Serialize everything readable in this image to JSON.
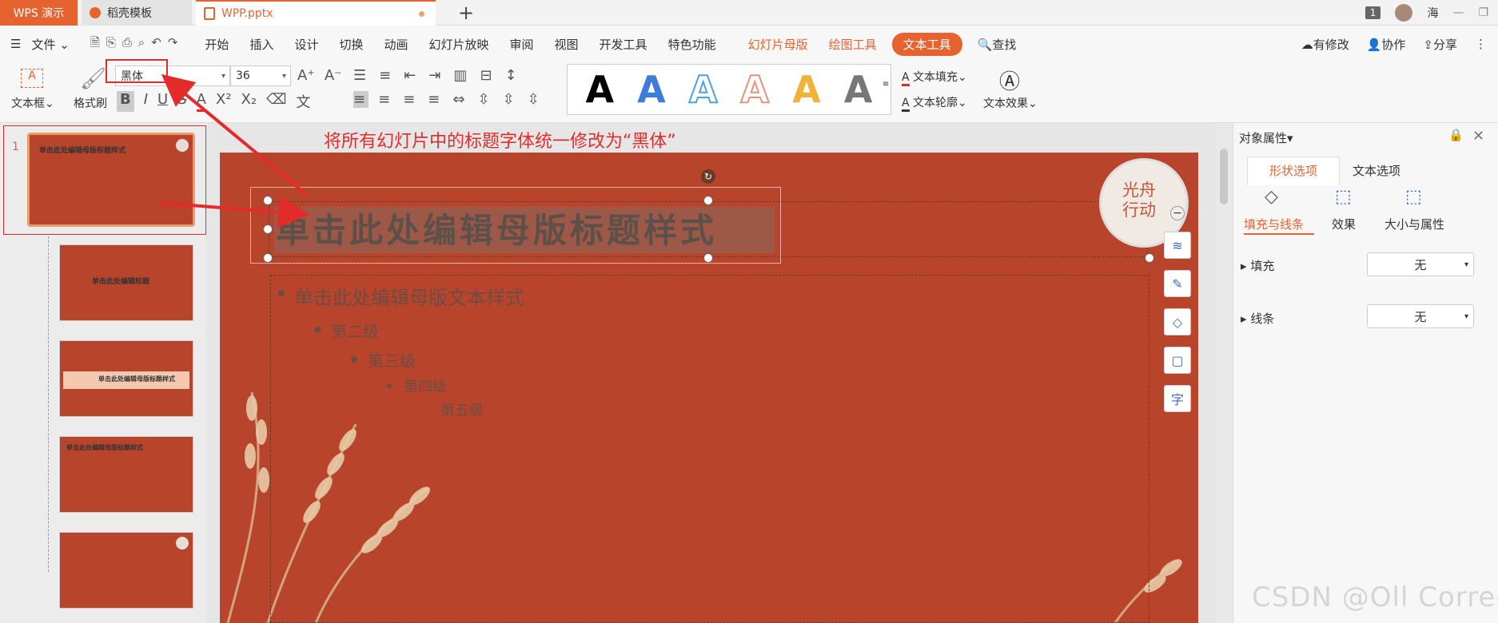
{
  "tabs": {
    "app": "WPS 演示",
    "template": "稻壳模板",
    "file": "WPP.pptx"
  },
  "titlebar_right": {
    "badge": "1",
    "user": "海"
  },
  "menu": {
    "file": "文件",
    "items": [
      "开始",
      "插入",
      "设计",
      "切换",
      "动画",
      "幻灯片放映",
      "审阅",
      "视图",
      "开发工具",
      "特色功能"
    ],
    "master": "幻灯片母版",
    "drawing": "绘图工具",
    "text_tool": "文本工具",
    "search": "查找",
    "modified": "有修改",
    "collab": "协作",
    "share": "分享"
  },
  "ribbon": {
    "textbox": "文本框",
    "format_painter": "格式刷",
    "font": "黑体",
    "size": "36",
    "text_fill": "文本填充",
    "text_outline": "文本轮廓",
    "text_effect": "文本效果",
    "style_letter": "A"
  },
  "annotation": "将所有幻灯片中的标题字体统一修改为“黑体”",
  "slide": {
    "title": "单击此处编辑母版标题样式",
    "body": "单击此处编辑母版文本样式",
    "levels": [
      "第二级",
      "第三级",
      "第四级",
      "第五级"
    ],
    "seal": [
      "光舟",
      "行动"
    ]
  },
  "thumbs": {
    "num": "1",
    "t1": "单击此处编辑母版标题样式",
    "t2": "单击此处编辑标题",
    "t3": "单击此处编辑母版标题样式",
    "t4": "单击此处编辑母版标题样式"
  },
  "panel": {
    "title": "对象属性",
    "tab_shape": "形状选项",
    "tab_text": "文本选项",
    "sub_fill": "填充与线条",
    "sub_effect": "效果",
    "sub_size": "大小与属性",
    "fill": "填充",
    "line": "线条",
    "none": "无"
  },
  "watermark": "CSDN @Oll Correct",
  "colors": {
    "accent": "#e6632f",
    "slide": "#b8452b",
    "annotation": "#e32b2b"
  }
}
